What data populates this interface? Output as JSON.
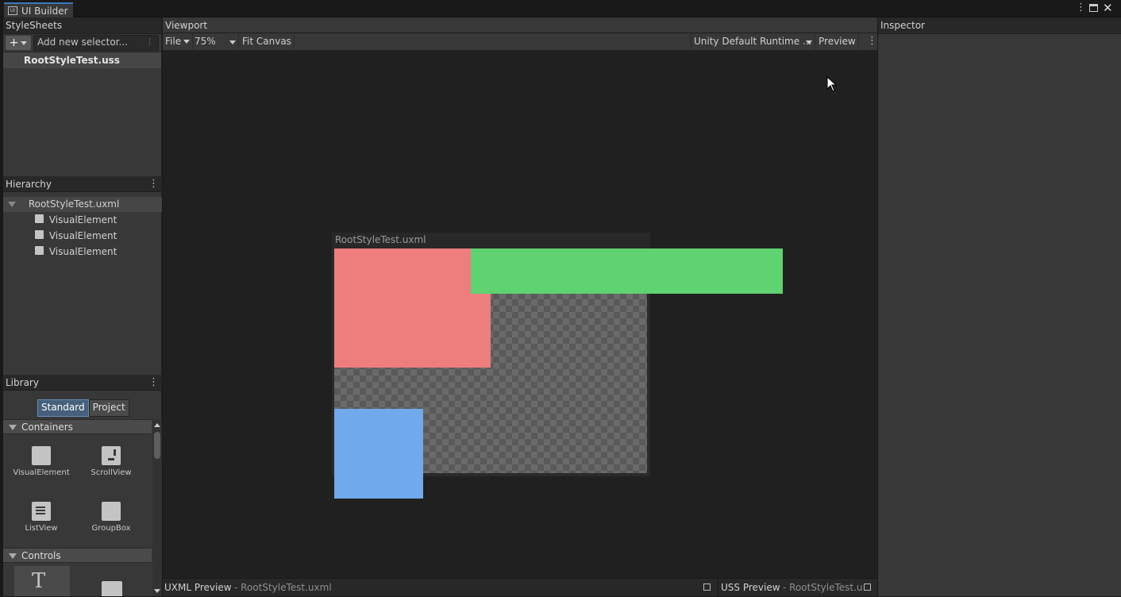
{
  "window": {
    "tab_title": "UI Builder",
    "tab_icon": "ui-builder-icon"
  },
  "stylesheets": {
    "header": "StyleSheets",
    "add_button": "+",
    "selector_placeholder": "Add new selector...",
    "items": [
      "RootStyleTest.uss"
    ]
  },
  "hierarchy": {
    "header": "Hierarchy",
    "root": "RootStyleTest.uxml",
    "children": [
      "VisualElement",
      "VisualElement",
      "VisualElement"
    ]
  },
  "library": {
    "header": "Library",
    "tabs": [
      "Standard",
      "Project"
    ],
    "active_tab": "Standard",
    "containers_label": "Containers",
    "containers": [
      "VisualElement",
      "ScrollView",
      "ListView",
      "GroupBox"
    ],
    "controls_label": "Controls"
  },
  "viewport": {
    "header": "Viewport",
    "file_menu": "File",
    "zoom": "75%",
    "fit_canvas": "Fit Canvas",
    "theme": "Unity Default Runtime ...",
    "preview": "Preview",
    "canvas_title": "RootStyleTest.uxml",
    "elements_colors": {
      "red": "#ee7e7e",
      "green": "#5fd271",
      "blue": "#70a9ec"
    },
    "uxml_preview_label": "UXML Preview",
    "uxml_preview_file": "- RootStyleTest.uxml",
    "uss_preview_label": "USS Preview",
    "uss_preview_file": "- RootStyleTest.uss"
  },
  "inspector": {
    "header": "Inspector"
  }
}
